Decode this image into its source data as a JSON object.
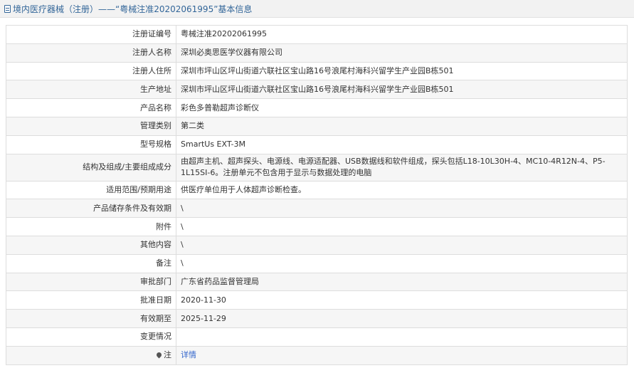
{
  "header": {
    "icon": "document-icon",
    "title": "境内医疗器械（注册）——“粤械注准20202061995”基本信息"
  },
  "rows": [
    {
      "label": "注册证编号",
      "value": "粤械注准20202061995"
    },
    {
      "label": "注册人名称",
      "value": "深圳必奥思医学仪器有限公司"
    },
    {
      "label": "注册人住所",
      "value": "深圳市坪山区坪山街道六联社区宝山路16号浪尾村海科兴留学生产业园B栋501"
    },
    {
      "label": "生产地址",
      "value": "深圳市坪山区坪山街道六联社区宝山路16号浪尾村海科兴留学生产业园B栋501"
    },
    {
      "label": "产品名称",
      "value": "彩色多普勒超声诊断仪"
    },
    {
      "label": "管理类别",
      "value": "第二类"
    },
    {
      "label": "型号规格",
      "value": "SmartUs EXT-3M"
    },
    {
      "label": "结构及组成/主要组成成分",
      "value": "由超声主机、超声探头、电源线、电源适配器、USB数据线和软件组成，探头包括L18-10L30H-4、MC10-4R12N-4、P5-1L15SI-6。注册单元不包含用于显示与数据处理的电脑"
    },
    {
      "label": "适用范围/预期用途",
      "value": "供医疗单位用于人体超声诊断检查。"
    },
    {
      "label": "产品储存条件及有效期",
      "value": "\\"
    },
    {
      "label": "附件",
      "value": "\\"
    },
    {
      "label": "其他内容",
      "value": "\\"
    },
    {
      "label": "备注",
      "value": "\\"
    },
    {
      "label": "审批部门",
      "value": "广东省药品监督管理局"
    },
    {
      "label": "批准日期",
      "value": "2020-11-30"
    },
    {
      "label": "有效期至",
      "value": "2025-11-29"
    },
    {
      "label": "变更情况",
      "value": ""
    }
  ],
  "note_row": {
    "icon": "pin-icon",
    "label": "注",
    "link_text": "详情"
  },
  "colors": {
    "header_text": "#336699",
    "link": "#3366cc",
    "border": "#dddddd",
    "header_bg": "#f2f2f2"
  }
}
